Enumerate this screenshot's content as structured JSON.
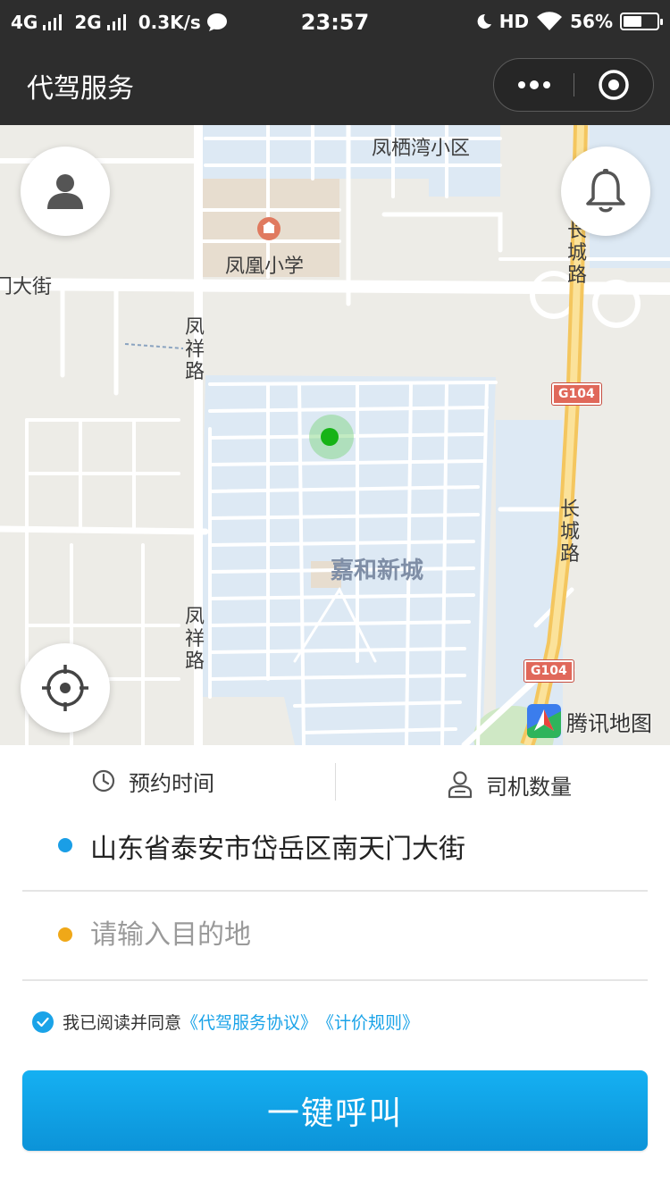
{
  "status_bar": {
    "network1": "4G",
    "network2": "2G",
    "speed": "0.3K/s",
    "time": "23:57",
    "hd": "HD",
    "battery_percent": "56%",
    "battery_level": 0.56
  },
  "nav": {
    "title": "代驾服务"
  },
  "map": {
    "labels": {
      "fengqiwan": "凤栖湾小区",
      "fenghuang_school": "凤凰小学",
      "dajie": "门大街",
      "fengxiang_road_1": "凤祥路",
      "fengxiang_road_2": "凤祥路",
      "changcheng_road_1": "长城路",
      "changcheng_road_2": "长城路",
      "jiahe": "嘉和新城",
      "g104_1": "G104",
      "g104_2": "G104"
    },
    "logo_text": "腾讯地图"
  },
  "options": {
    "reserve_time": "预约时间",
    "driver_count": "司机数量"
  },
  "addresses": {
    "origin": "山东省泰安市岱岳区南天门大街",
    "destination_placeholder": "请输入目的地",
    "destination_value": ""
  },
  "agreement": {
    "checked": true,
    "prefix": "我已阅读并同意",
    "link1": "《代驾服务协议》",
    "link2": "《计价规则》"
  },
  "call_button": {
    "label": "一键呼叫"
  },
  "colors": {
    "bar_bg": "#2d2d2d",
    "accent_blue": "#1aa3e8",
    "origin_dot": "#1a9ee6",
    "destination_dot": "#f0a818",
    "marker_green": "#16b316"
  },
  "icons": {
    "profile": "person-icon",
    "notifications": "bell-icon",
    "locate": "crosshair-icon",
    "reserve_time": "clock-icon",
    "driver_count": "driver-icon",
    "capsule_more": "more-dots-icon",
    "capsule_close": "target-close-icon"
  }
}
